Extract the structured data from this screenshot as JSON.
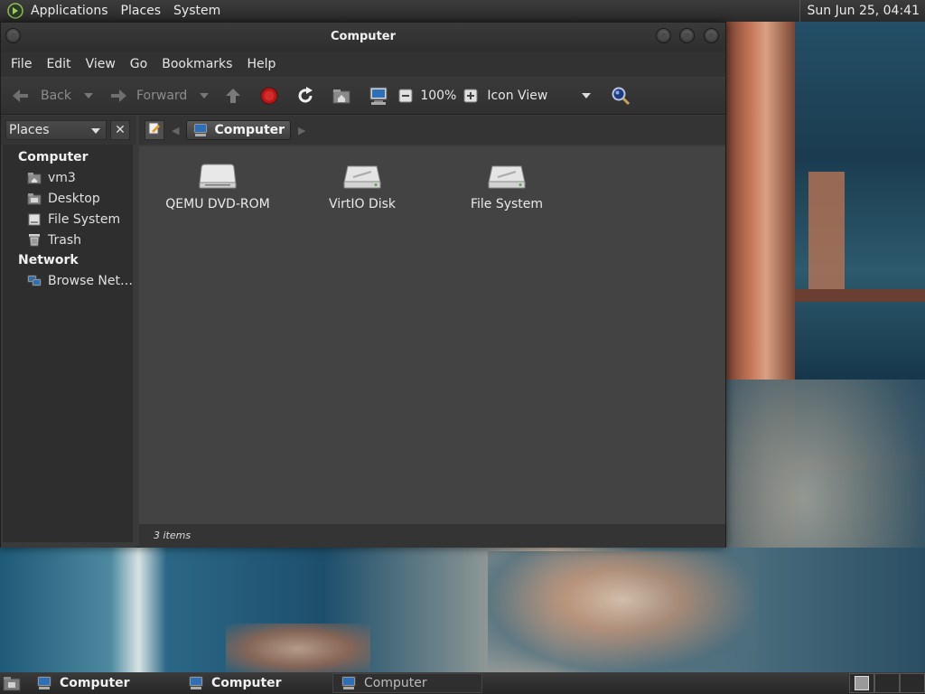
{
  "top_panel": {
    "menus": [
      "Applications",
      "Places",
      "System"
    ],
    "clock": "Sun Jun 25, 04:41"
  },
  "window": {
    "title": "Computer",
    "menubar": [
      "File",
      "Edit",
      "View",
      "Go",
      "Bookmarks",
      "Help"
    ],
    "toolbar": {
      "back_label": "Back",
      "forward_label": "Forward",
      "zoom": "100%",
      "view_mode": "Icon View"
    },
    "sidebar": {
      "selector": "Places",
      "sections": [
        {
          "title": "Computer",
          "items": [
            {
              "label": "vm3",
              "icon": "home-folder-icon"
            },
            {
              "label": "Desktop",
              "icon": "desktop-folder-icon"
            },
            {
              "label": "File System",
              "icon": "drive-icon"
            },
            {
              "label": "Trash",
              "icon": "trash-icon"
            }
          ]
        },
        {
          "title": "Network",
          "items": [
            {
              "label": "Browse Net…",
              "icon": "network-icon"
            }
          ]
        }
      ]
    },
    "pathbar": {
      "crumb": "Computer"
    },
    "files": [
      {
        "label": "QEMU DVD-ROM",
        "icon": "optical-drive-icon"
      },
      {
        "label": "VirtIO Disk",
        "icon": "hard-disk-icon"
      },
      {
        "label": "File System",
        "icon": "hard-disk-icon"
      }
    ],
    "status": "3 items"
  },
  "taskbar": {
    "tasks": [
      "Computer",
      "Computer",
      "Computer"
    ]
  }
}
